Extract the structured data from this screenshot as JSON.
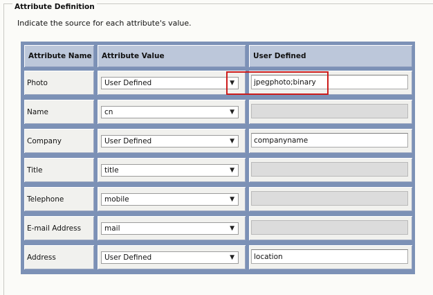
{
  "section": {
    "legend": "Attribute Definition",
    "description": "Indicate the source for each attribute's value."
  },
  "table": {
    "headers": [
      "Attribute Name",
      "Attribute Value",
      "User Defined"
    ],
    "rows": [
      {
        "name": "Photo",
        "value": "User Defined",
        "user_defined": "jpegphoto;binary",
        "enabled": true
      },
      {
        "name": "Name",
        "value": "cn",
        "user_defined": "",
        "enabled": false
      },
      {
        "name": "Company",
        "value": "User Defined",
        "user_defined": "companyname",
        "enabled": true
      },
      {
        "name": "Title",
        "value": "title",
        "user_defined": "",
        "enabled": false
      },
      {
        "name": "Telephone",
        "value": "mobile",
        "user_defined": "",
        "enabled": false
      },
      {
        "name": "E-mail Address",
        "value": "mail",
        "user_defined": "",
        "enabled": false
      },
      {
        "name": "Address",
        "value": "User Defined",
        "user_defined": "location",
        "enabled": true
      }
    ]
  },
  "colors": {
    "grid_border": "#7c91b6",
    "header_bg": "#bcc7da",
    "highlight": "#cc1b1b"
  },
  "icons": {
    "dropdown": "chevron-down-icon"
  }
}
